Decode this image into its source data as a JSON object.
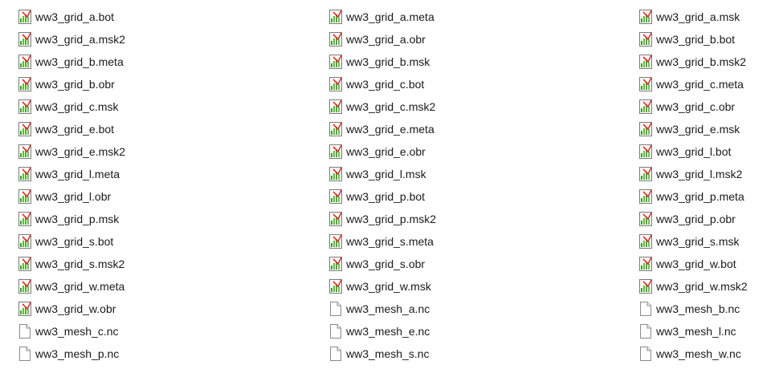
{
  "view": "file-list",
  "icons": {
    "grid": "chart-file-icon",
    "mesh": "blank-file-icon"
  },
  "files": [
    {
      "name": "ww3_grid_a.bot",
      "icon": "grid"
    },
    {
      "name": "ww3_grid_a.msk2",
      "icon": "grid"
    },
    {
      "name": "ww3_grid_b.meta",
      "icon": "grid"
    },
    {
      "name": "ww3_grid_b.obr",
      "icon": "grid"
    },
    {
      "name": "ww3_grid_c.msk",
      "icon": "grid"
    },
    {
      "name": "ww3_grid_e.bot",
      "icon": "grid"
    },
    {
      "name": "ww3_grid_e.msk2",
      "icon": "grid"
    },
    {
      "name": "ww3_grid_l.meta",
      "icon": "grid"
    },
    {
      "name": "ww3_grid_l.obr",
      "icon": "grid"
    },
    {
      "name": "ww3_grid_p.msk",
      "icon": "grid"
    },
    {
      "name": "ww3_grid_s.bot",
      "icon": "grid"
    },
    {
      "name": "ww3_grid_s.msk2",
      "icon": "grid"
    },
    {
      "name": "ww3_grid_w.meta",
      "icon": "grid"
    },
    {
      "name": "ww3_grid_w.obr",
      "icon": "grid"
    },
    {
      "name": "ww3_mesh_c.nc",
      "icon": "mesh"
    },
    {
      "name": "ww3_mesh_p.nc",
      "icon": "mesh"
    },
    {
      "name": "ww3_grid_a.meta",
      "icon": "grid"
    },
    {
      "name": "ww3_grid_a.obr",
      "icon": "grid"
    },
    {
      "name": "ww3_grid_b.msk",
      "icon": "grid"
    },
    {
      "name": "ww3_grid_c.bot",
      "icon": "grid"
    },
    {
      "name": "ww3_grid_c.msk2",
      "icon": "grid"
    },
    {
      "name": "ww3_grid_e.meta",
      "icon": "grid"
    },
    {
      "name": "ww3_grid_e.obr",
      "icon": "grid"
    },
    {
      "name": "ww3_grid_l.msk",
      "icon": "grid"
    },
    {
      "name": "ww3_grid_p.bot",
      "icon": "grid"
    },
    {
      "name": "ww3_grid_p.msk2",
      "icon": "grid"
    },
    {
      "name": "ww3_grid_s.meta",
      "icon": "grid"
    },
    {
      "name": "ww3_grid_s.obr",
      "icon": "grid"
    },
    {
      "name": "ww3_grid_w.msk",
      "icon": "grid"
    },
    {
      "name": "ww3_mesh_a.nc",
      "icon": "mesh"
    },
    {
      "name": "ww3_mesh_e.nc",
      "icon": "mesh"
    },
    {
      "name": "ww3_mesh_s.nc",
      "icon": "mesh"
    },
    {
      "name": "ww3_grid_a.msk",
      "icon": "grid"
    },
    {
      "name": "ww3_grid_b.bot",
      "icon": "grid"
    },
    {
      "name": "ww3_grid_b.msk2",
      "icon": "grid"
    },
    {
      "name": "ww3_grid_c.meta",
      "icon": "grid"
    },
    {
      "name": "ww3_grid_c.obr",
      "icon": "grid"
    },
    {
      "name": "ww3_grid_e.msk",
      "icon": "grid"
    },
    {
      "name": "ww3_grid_l.bot",
      "icon": "grid"
    },
    {
      "name": "ww3_grid_l.msk2",
      "icon": "grid"
    },
    {
      "name": "ww3_grid_p.meta",
      "icon": "grid"
    },
    {
      "name": "ww3_grid_p.obr",
      "icon": "grid"
    },
    {
      "name": "ww3_grid_s.msk",
      "icon": "grid"
    },
    {
      "name": "ww3_grid_w.bot",
      "icon": "grid"
    },
    {
      "name": "ww3_grid_w.msk2",
      "icon": "grid"
    },
    {
      "name": "ww3_mesh_b.nc",
      "icon": "mesh"
    },
    {
      "name": "ww3_mesh_l.nc",
      "icon": "mesh"
    },
    {
      "name": "ww3_mesh_w.nc",
      "icon": "mesh"
    }
  ]
}
